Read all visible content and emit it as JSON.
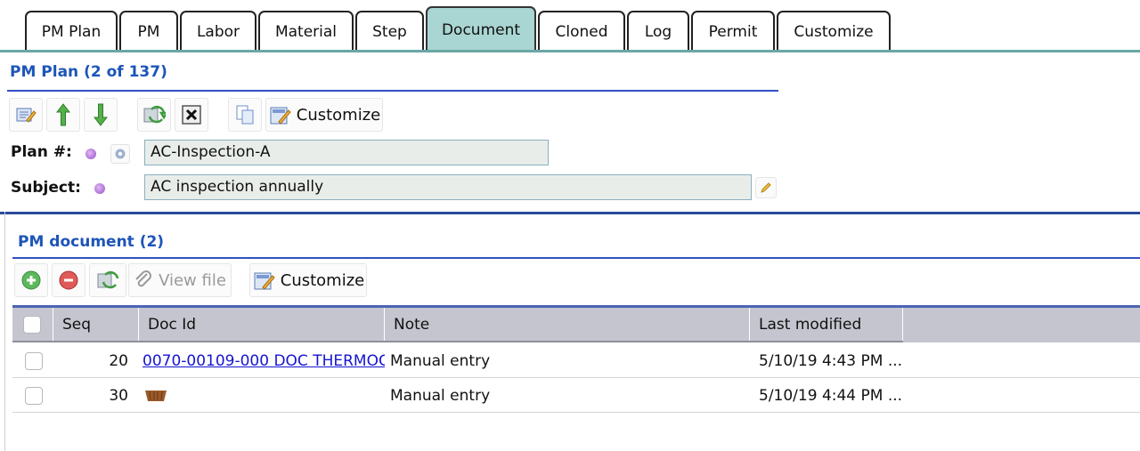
{
  "tabs": [
    {
      "label": "PM Plan"
    },
    {
      "label": "PM"
    },
    {
      "label": "Labor"
    },
    {
      "label": "Material"
    },
    {
      "label": "Step"
    },
    {
      "label": "Document",
      "active": true
    },
    {
      "label": "Cloned"
    },
    {
      "label": "Log"
    },
    {
      "label": "Permit"
    },
    {
      "label": "Customize"
    }
  ],
  "plan": {
    "title": "PM Plan (2 of 137)",
    "toolbar": {
      "customize_label": "Customize"
    },
    "plan_no_label": "Plan #:",
    "plan_no_value": "AC-Inspection-A",
    "subject_label": "Subject:",
    "subject_value": "AC inspection annually"
  },
  "documents": {
    "title": "PM document (2)",
    "toolbar": {
      "view_file_label": "View file",
      "customize_label": "Customize"
    },
    "columns": {
      "seq": "Seq",
      "doc_id": "Doc Id",
      "note": "Note",
      "last_modified": "Last modified"
    },
    "rows": [
      {
        "seq": "20",
        "doc_id": "0070-00109-000 DOC THERMOC",
        "note": "Manual entry",
        "last_modified": "5/10/19 4:43 PM ..."
      },
      {
        "seq": "30",
        "doc_id": "",
        "note": "Manual entry",
        "last_modified": "5/10/19 4:44 PM ..."
      }
    ]
  },
  "colors": {
    "accent": "#1d55b8",
    "tab_active": "#a9d5d2",
    "header_bg": "#c5c5cf",
    "link": "#1515d0"
  }
}
